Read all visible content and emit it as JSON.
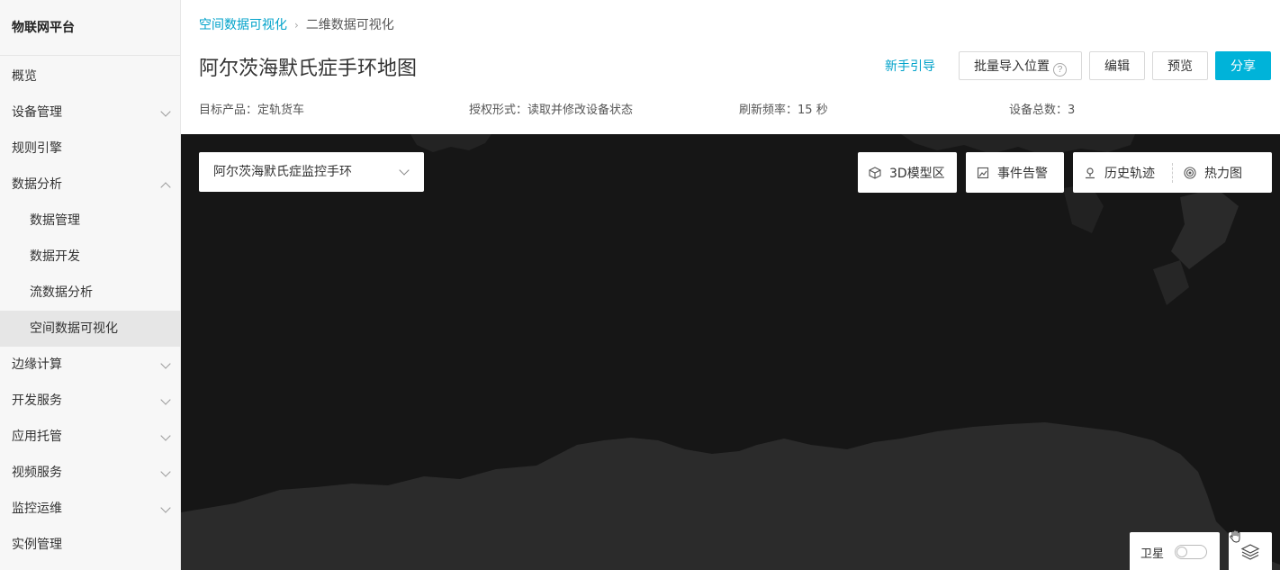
{
  "sidebar": {
    "brand": "物联网平台",
    "items": [
      {
        "label": "概览"
      },
      {
        "label": "设备管理"
      },
      {
        "label": "规则引擎"
      },
      {
        "label": "数据分析"
      },
      {
        "label": "数据管理"
      },
      {
        "label": "数据开发"
      },
      {
        "label": "流数据分析"
      },
      {
        "label": "空间数据可视化"
      },
      {
        "label": "边缘计算"
      },
      {
        "label": "开发服务"
      },
      {
        "label": "应用托管"
      },
      {
        "label": "视频服务"
      },
      {
        "label": "监控运维"
      },
      {
        "label": "实例管理"
      }
    ]
  },
  "breadcrumb": {
    "parent": "空间数据可视化",
    "separator": "›",
    "current": "二维数据可视化"
  },
  "page": {
    "title": "阿尔茨海默氏症手环地图"
  },
  "actions": {
    "guide": "新手引导",
    "batch_import": "批量导入位置",
    "help": "?",
    "edit": "编辑",
    "preview": "预览",
    "share": "分享"
  },
  "meta": {
    "product_label": "目标产品：",
    "product_value": "定轨货车",
    "auth_label": "授权形式：",
    "auth_value": "读取并修改设备状态",
    "refresh_label": "刷新频率：",
    "refresh_value": "15 秒",
    "devices_label": "设备总数：",
    "devices_value": "3"
  },
  "map": {
    "device_select": "阿尔茨海默氏症监控手环",
    "tools": {
      "model3d": "3D模型区",
      "alarm": "事件告警",
      "history": "历史轨迹",
      "heatmap": "热力图"
    },
    "satellite": "卫星",
    "satellite_on": false
  },
  "colors": {
    "accent": "#00a2ca",
    "primary_button": "#00b3d9",
    "map_water": "#161616",
    "map_land": "#2b2b2b"
  }
}
